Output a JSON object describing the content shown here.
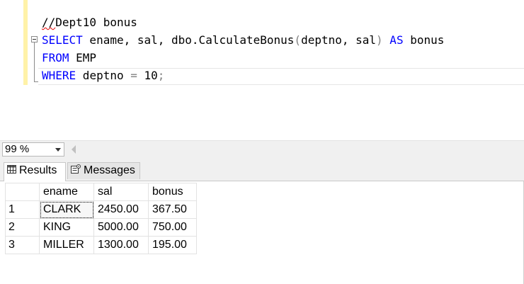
{
  "editor": {
    "lines": {
      "comment_prefix": "//",
      "comment_text": "Dept10 bonus",
      "select_kw": "SELECT",
      "select_cols": " ename, sal, dbo.CalculateBonus",
      "paren_open": "(",
      "args": "deptno, sal",
      "paren_close": ")",
      "as_kw": " AS",
      "alias": " bonus",
      "from_kw": "FROM",
      "table": " EMP",
      "where_kw": "WHERE",
      "where_col": " deptno ",
      "eq": "=",
      "where_val": " 10",
      "semicolon": ";"
    }
  },
  "status": {
    "zoom": "99 %"
  },
  "tabs": {
    "results": "Results",
    "messages": "Messages"
  },
  "grid": {
    "columns": [
      "ename",
      "sal",
      "bonus"
    ],
    "rows": [
      {
        "num": "1",
        "ename": "CLARK",
        "sal": "2450.00",
        "bonus": "367.50"
      },
      {
        "num": "2",
        "ename": "KING",
        "sal": "5000.00",
        "bonus": "750.00"
      },
      {
        "num": "3",
        "ename": "MILLER",
        "sal": "1300.00",
        "bonus": "195.00"
      }
    ]
  },
  "colors": {
    "keyword": "#0000ff",
    "comment": "#008000",
    "operator": "#808080",
    "change_bar": "#fff2a8"
  },
  "icons": {
    "results_tab": "grid-icon",
    "messages_tab": "messages-icon",
    "collapse": "outline-collapse-icon",
    "zoom_dropdown": "chevron-down-icon",
    "scroll": "scroll-left-icon"
  }
}
